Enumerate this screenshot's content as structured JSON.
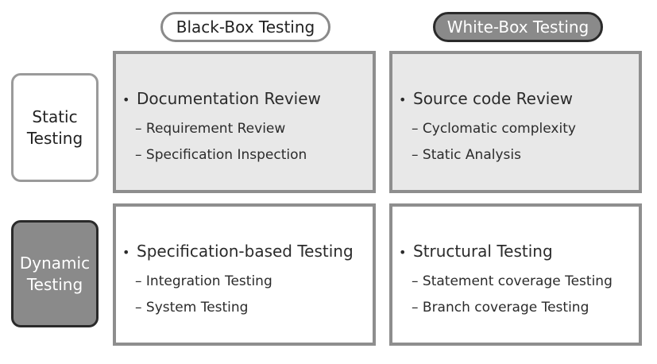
{
  "columns": {
    "black_box": "Black-Box Testing",
    "white_box": "White-Box Testing"
  },
  "rows": {
    "static": [
      "Static",
      "Testing"
    ],
    "dynamic": [
      "Dynamic",
      "Testing"
    ]
  },
  "cells": {
    "black_static": {
      "main": "Documentation Review",
      "subs": [
        "– Requirement Review",
        "–  Specification Inspection"
      ]
    },
    "white_static": {
      "main": "Source code Review",
      "subs": [
        "– Cyclomatic complexity",
        "– Static Analysis"
      ]
    },
    "black_dynamic": {
      "main": "Specification-based Testing",
      "subs": [
        "– Integration Testing",
        "– System Testing"
      ]
    },
    "white_dynamic": {
      "main": "Structural Testing",
      "subs": [
        "– Statement coverage Testing",
        "– Branch coverage Testing"
      ]
    }
  },
  "bullet": "•",
  "colors": {
    "gray_cell": "#e8e8e8",
    "border": "#8e8e8e",
    "dark_fill": "#8a8a8a"
  }
}
